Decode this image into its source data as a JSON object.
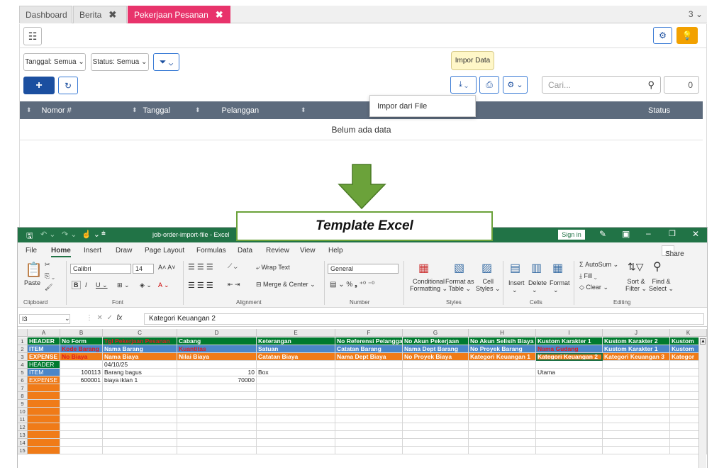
{
  "app": {
    "tabs": [
      {
        "label": "Dashboard"
      },
      {
        "label": "Berita"
      },
      {
        "label": "Pekerjaan Pesanan"
      }
    ],
    "tab_count": "3",
    "filters": {
      "tanggal": "Tanggal: Semua",
      "status": "Status: Semua"
    },
    "tooltip": "Impor Data",
    "dropdown_item": "Impor dari File",
    "search_placeholder": "Cari...",
    "count_value": "0",
    "columns": [
      "Nomor #",
      "Tanggal",
      "Pelanggan",
      "",
      "Status"
    ],
    "empty_text": "Belum ada data",
    "colors": {
      "active_tab": "#e8336b",
      "primary": "#1b4fa0",
      "header": "#5d6b7d",
      "warning": "#f2a100"
    }
  },
  "annotation": {
    "label": "Template Excel",
    "arrow_color": "#6ba23a"
  },
  "excel": {
    "title": "job-order-import-file  -  Excel",
    "sign_in": "Sign in",
    "menu": [
      "File",
      "Home",
      "Insert",
      "Draw",
      "Page Layout",
      "Formulas",
      "Data",
      "Review",
      "View",
      "Help"
    ],
    "share": "Share",
    "ribbon": {
      "clipboard": "Clipboard",
      "font": "Font",
      "alignment": "Alignment",
      "number": "Number",
      "styles": "Styles",
      "cells": "Cells",
      "editing": "Editing",
      "paste": "Paste",
      "font_name": "Calibri",
      "font_size": "14",
      "wrap_text": "Wrap Text",
      "merge_center": "Merge & Center",
      "number_format": "General",
      "conditional": "Conditional",
      "formatting": "Formatting",
      "format_as": "Format as",
      "table": "Table",
      "cell": "Cell",
      "styles_btn": "Styles",
      "insert": "Insert",
      "delete": "Delete",
      "format": "Format",
      "autosum": "AutoSum",
      "fill": "Fill",
      "clear": "Clear",
      "sort": "Sort &",
      "filter": "Filter",
      "find": "Find &",
      "select": "Select"
    },
    "name_box": "I3",
    "formula": "Kategori Keuangan 2",
    "col_headers": [
      "A",
      "B",
      "C",
      "D",
      "E",
      "F",
      "G",
      "H",
      "I",
      "J",
      "K"
    ],
    "rows": [
      [
        "HEADER",
        "No Form",
        "Tgl Pekerjaan Pesanan",
        "Cabang",
        "Keterangan",
        "No Referensi Pelanggan",
        "No Akun Pekerjaan",
        "No Akun Selisih Biaya",
        "Kustom Karakter 1",
        "Kustom Karakter 2",
        "Kustom"
      ],
      [
        "ITEM",
        "Kode Barang",
        "Nama Barang",
        "Kuantitas",
        "Satuan",
        "Catatan Barang",
        "Nama Dept Barang",
        "No Proyek Barang",
        "Nama Gudang",
        "Kustom Karakter 1",
        "Kustom"
      ],
      [
        "EXPENSE",
        "No Biaya",
        "Nama Biaya",
        "Nilai Biaya",
        "Catatan Biaya",
        "Nama Dept Biaya",
        "No Proyek Biaya",
        "Kategori Keuangan 1",
        "Kategori Keuangan 2",
        "Kategori Keuangan 3",
        "Kategor"
      ],
      [
        "HEADER",
        "",
        "04/10/25",
        "",
        "",
        "",
        "",
        "",
        "",
        "",
        ""
      ],
      [
        "ITEM",
        "100113",
        "Barang bagus",
        "10",
        "Box",
        "",
        "",
        "",
        "Utama",
        "",
        ""
      ],
      [
        "EXPENSE",
        "600001",
        "biaya iklan 1",
        "70000",
        "",
        "",
        "",
        "",
        "",
        "",
        ""
      ],
      [
        "",
        "",
        "",
        "",
        "",
        "",
        "",
        "",
        "",
        "",
        ""
      ],
      [
        "",
        "",
        "",
        "",
        "",
        "",
        "",
        "",
        "",
        "",
        ""
      ],
      [
        "",
        "",
        "",
        "",
        "",
        "",
        "",
        "",
        "",
        "",
        ""
      ],
      [
        "",
        "",
        "",
        "",
        "",
        "",
        "",
        "",
        "",
        "",
        ""
      ],
      [
        "",
        "",
        "",
        "",
        "",
        "",
        "",
        "",
        "",
        "",
        ""
      ],
      [
        "",
        "",
        "",
        "",
        "",
        "",
        "",
        "",
        "",
        "",
        ""
      ],
      [
        "",
        "",
        "",
        "",
        "",
        "",
        "",
        "",
        "",
        "",
        ""
      ],
      [
        "",
        "",
        "",
        "",
        "",
        "",
        "",
        "",
        "",
        "",
        ""
      ],
      [
        "",
        "",
        "",
        "",
        "",
        "",
        "",
        "",
        "",
        "",
        ""
      ]
    ],
    "row_numbers": [
      "1",
      "2",
      "3",
      "4",
      "5",
      "6",
      "7",
      "8",
      "9",
      "10",
      "11",
      "12",
      "13",
      "14",
      "15"
    ],
    "colors": {
      "green": "#007a2f",
      "blue": "#4a86c8",
      "orange": "#f07b18",
      "red": "#e0191f",
      "title_bar": "#217346"
    }
  }
}
